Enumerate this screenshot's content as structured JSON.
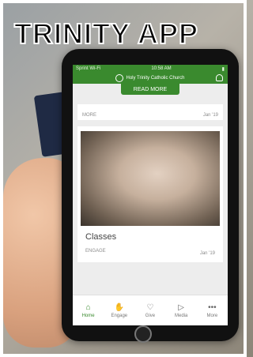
{
  "overlay": {
    "title": "TRINITY APP"
  },
  "app": {
    "status_bar": {
      "carrier": "Sprint Wi-Fi",
      "time": "10:58 AM"
    },
    "brand": "Holy Trinity Catholic Church",
    "read_more": "READ MORE",
    "card1": {
      "tag": "MORE",
      "date": "Jan '19"
    },
    "card2": {
      "title": "Classes",
      "tag": "ENGAGE",
      "date": "Jan '19"
    },
    "tabs": [
      {
        "label": "Home"
      },
      {
        "label": "Engage"
      },
      {
        "label": "Give"
      },
      {
        "label": "Media"
      },
      {
        "label": "More"
      }
    ]
  }
}
